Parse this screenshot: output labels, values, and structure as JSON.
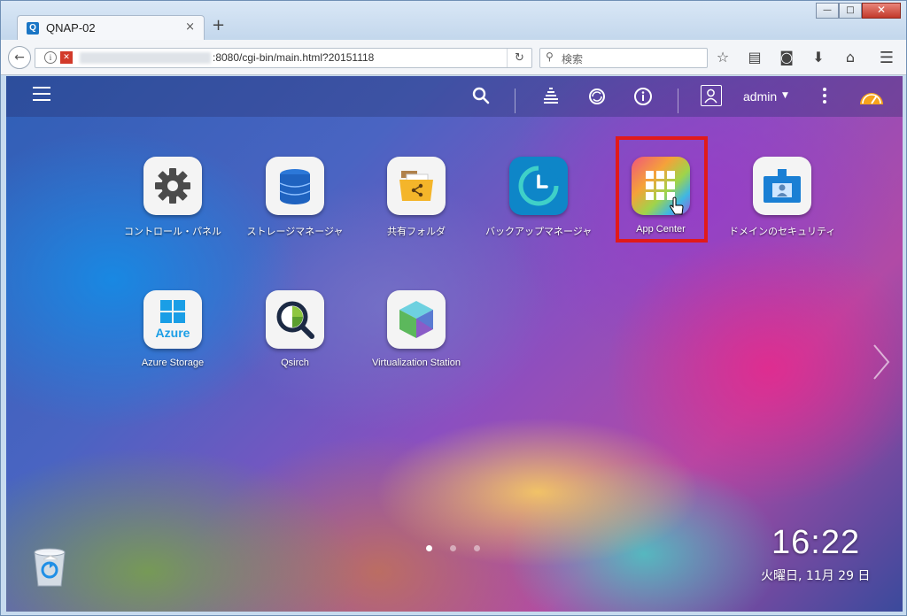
{
  "browser": {
    "tab_title": "QNAP-02",
    "tab_favicon": "Q",
    "tab_close": "×",
    "new_tab": "+",
    "url_path": ":8080/cgi-bin/main.html?20151118",
    "search_placeholder": "検索",
    "window_controls": {
      "minimize": "—",
      "maximize": "□",
      "close": "✕"
    }
  },
  "topbar": {
    "user": "admin",
    "icons": [
      "menu-icon",
      "search-icon",
      "task-stack-icon",
      "sync-icon",
      "info-icon",
      "user-icon",
      "more-icon",
      "dashboard-gauge-icon"
    ]
  },
  "apps": [
    {
      "label": "コントロール・パネル",
      "icon": "gear-icon"
    },
    {
      "label": "ストレージマネージャ",
      "icon": "database-icon"
    },
    {
      "label": "共有フォルダ",
      "icon": "shared-folder-icon"
    },
    {
      "label": "バックアップマネージャ",
      "icon": "backup-clock-icon"
    },
    {
      "label": "App Center",
      "icon": "app-grid-icon"
    },
    {
      "label": "ドメインのセキュリティ",
      "icon": "id-badge-icon"
    },
    {
      "label": "Azure Storage",
      "icon": "azure-windows-icon"
    },
    {
      "label": "Qsirch",
      "icon": "qsirch-magnifier-icon"
    },
    {
      "label": "Virtualization Station",
      "icon": "cube-icon"
    }
  ],
  "azure_tile_text": "Azure",
  "clock": {
    "time": "16:22",
    "date": "火曜日, 11月 29 日"
  },
  "pager": {
    "pages": 3,
    "current": 1
  },
  "colors": {
    "highlight": "#e11a1a",
    "accent": "#1b76c5"
  }
}
